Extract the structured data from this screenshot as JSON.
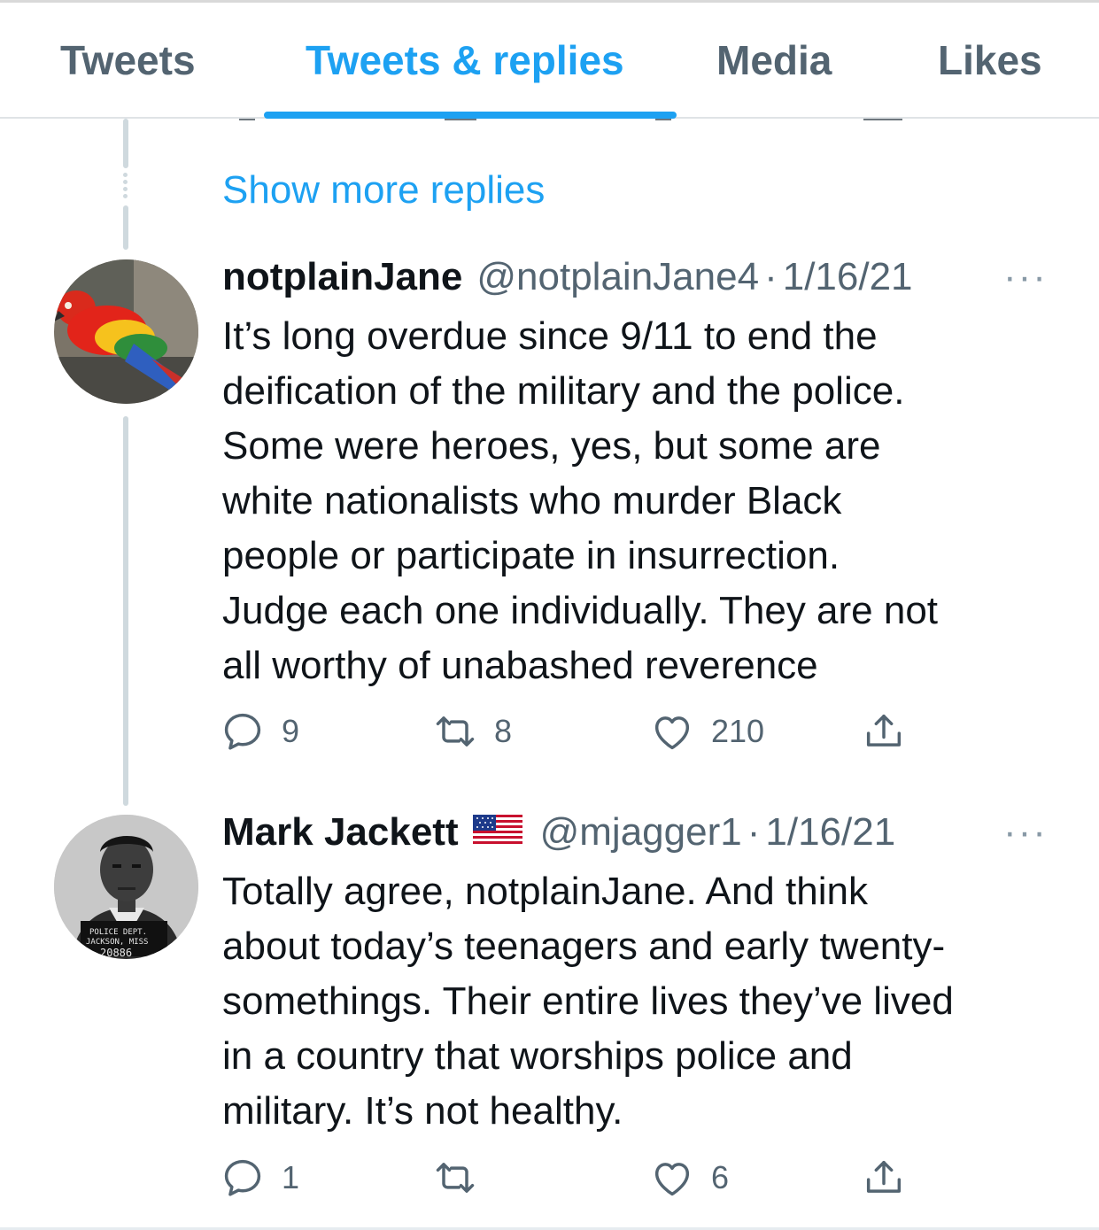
{
  "tabs": [
    {
      "label": "Tweets"
    },
    {
      "label": "Tweets & replies"
    },
    {
      "label": "Media"
    },
    {
      "label": "Likes"
    }
  ],
  "active_tab": "Tweets & replies",
  "show_more_label": "Show more replies",
  "tweets": [
    {
      "name": "notplainJane",
      "handle": "@notplainJane4",
      "separator": "·",
      "date": "1/16/21",
      "more_icon": "···",
      "body_lines": [
        "It’s long overdue since 9/11 to end the",
        "deification of the military and the police.",
        "Some were heroes, yes, but some are",
        "white nationalists who murder Black",
        "people or participate in insurrection.",
        "Judge each one individually. They are not",
        "all worthy of unabashed reverence"
      ],
      "replies": "9",
      "retweets": "8",
      "likes": "210"
    },
    {
      "name": "Mark Jackett",
      "flag_icon": "us-flag-icon",
      "handle": "@mjagger1",
      "separator": "·",
      "date": "1/16/21",
      "more_icon": "···",
      "body_lines": [
        "Totally agree, notplainJane. And think",
        "about today’s teenagers and early twenty-",
        "somethings. Their entire lives they’ve lived",
        "in a country that worships police and",
        "military. It’s not healthy."
      ],
      "replies": "1",
      "retweets": "",
      "likes": "6",
      "avatar_placard": [
        "POLICE   DEPT.",
        "JACKSON, MISS",
        "20886"
      ]
    }
  ],
  "colors": {
    "accent": "#1da1f2",
    "muted": "#536471",
    "thread_line": "#cfd9de",
    "text": "#0f1419"
  }
}
